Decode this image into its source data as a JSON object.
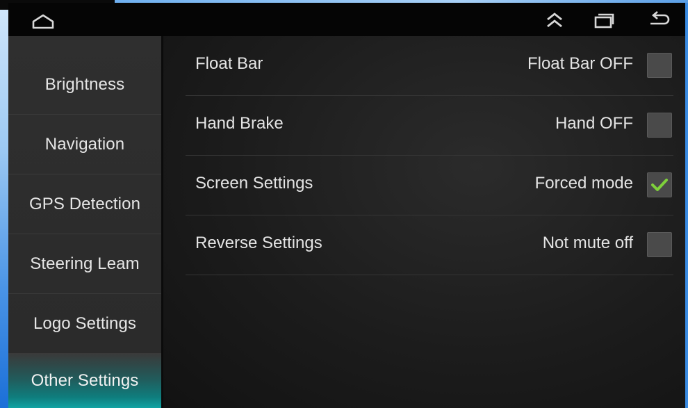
{
  "status_bar": {
    "icons": [
      "home-icon",
      "double-chevron-up-icon",
      "recents-icon",
      "back-icon"
    ]
  },
  "sidebar": {
    "items": [
      {
        "label": "Brightness",
        "active": false
      },
      {
        "label": "Navigation",
        "active": false
      },
      {
        "label": "GPS Detection",
        "active": false
      },
      {
        "label": "Steering Leam",
        "active": false
      },
      {
        "label": "Logo Settings",
        "active": false
      },
      {
        "label": "Other Settings",
        "active": true
      }
    ]
  },
  "settings": {
    "rows": [
      {
        "label": "Float Bar",
        "status": "Float Bar OFF",
        "checked": false
      },
      {
        "label": "Hand Brake",
        "status": "Hand OFF",
        "checked": false
      },
      {
        "label": "Screen Settings",
        "status": "Forced mode",
        "checked": true
      },
      {
        "label": "Reverse Settings",
        "status": "Not mute off",
        "checked": false
      }
    ]
  },
  "colors": {
    "accent_teal": "#11a3a3",
    "check_green": "#7fd13b",
    "frame_blue": "#2f7fd6"
  }
}
